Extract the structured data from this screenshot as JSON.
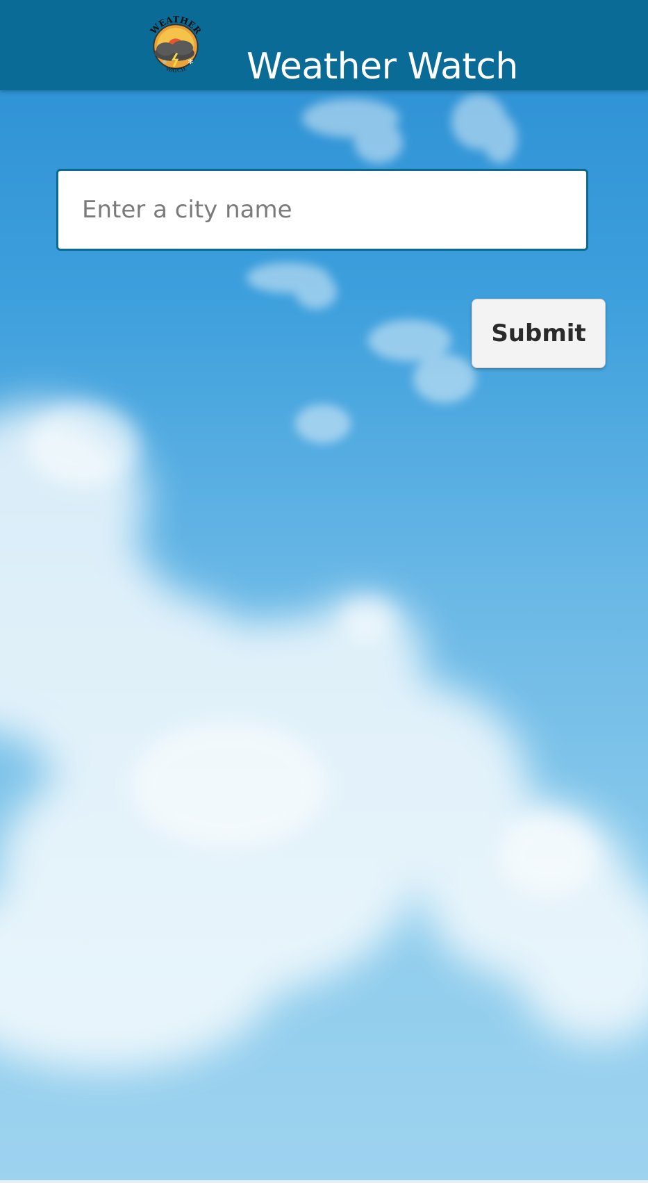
{
  "app": {
    "title": "Weather Watch",
    "logo": {
      "text_top": "WEATHER",
      "text_bottom": "WATCH",
      "icon": "storm-cloud-sun-logo"
    }
  },
  "search": {
    "placeholder": "Enter a city name",
    "value": ""
  },
  "actions": {
    "submit_label": "Submit"
  },
  "background": {
    "icon": "sky-clouds-background"
  },
  "colors": {
    "header": "#0a6b96",
    "input_border": "#0d6a8f",
    "button_bg": "#f3f3f3",
    "sky_top": "#2b8ed2",
    "sky_bottom": "#9ed3ef"
  }
}
